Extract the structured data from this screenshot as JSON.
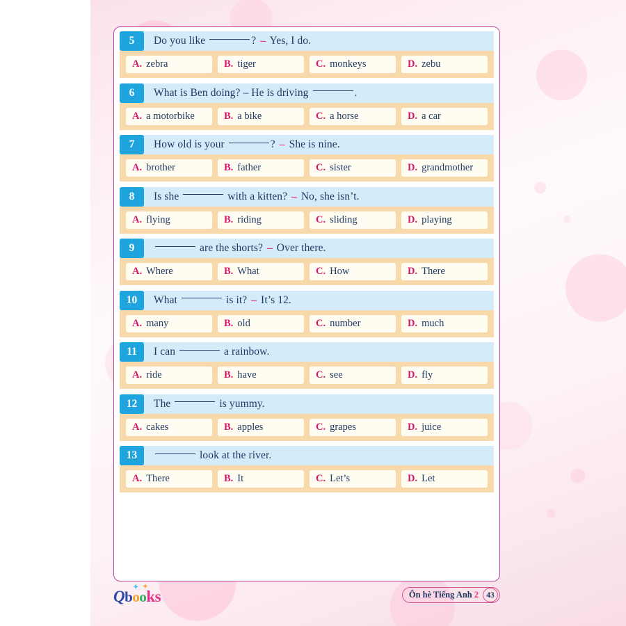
{
  "page": {
    "background_color": "#fbe2ea",
    "card_border_color": "#c0499c",
    "accent_blue": "#1fa5dd",
    "band_blue": "#d4ecfa",
    "band_orange": "#f8d9ab",
    "option_box_color": "#fffdf2",
    "letter_color": "#d6176b",
    "text_color": "#1f3a63",
    "dash_color": "#e8308a"
  },
  "questions": [
    {
      "number": "5",
      "prompt_before": "Do you like ",
      "prompt_after": "? ",
      "dash": "–",
      "prompt_tail": " Yes, I do.",
      "options": [
        {
          "letter": "A.",
          "text": "zebra"
        },
        {
          "letter": "B.",
          "text": "tiger"
        },
        {
          "letter": "C.",
          "text": "monkeys"
        },
        {
          "letter": "D.",
          "text": "zebu"
        }
      ]
    },
    {
      "number": "6",
      "prompt_before": "What is Ben doing? – He is driving ",
      "prompt_after": ".",
      "dash": "",
      "prompt_tail": "",
      "options": [
        {
          "letter": "A.",
          "text": "a motorbike"
        },
        {
          "letter": "B.",
          "text": "a bike"
        },
        {
          "letter": "C.",
          "text": "a horse"
        },
        {
          "letter": "D.",
          "text": "a car"
        }
      ]
    },
    {
      "number": "7",
      "prompt_before": "How old is your ",
      "prompt_after": "? ",
      "dash": "–",
      "prompt_tail": " She is nine.",
      "options": [
        {
          "letter": "A.",
          "text": "brother"
        },
        {
          "letter": "B.",
          "text": "father"
        },
        {
          "letter": "C.",
          "text": "sister"
        },
        {
          "letter": "D.",
          "text": "grandmother"
        }
      ]
    },
    {
      "number": "8",
      "prompt_before": "Is she ",
      "prompt_after": " with a kitten? ",
      "dash": "–",
      "prompt_tail": " No, she isn’t.",
      "options": [
        {
          "letter": "A.",
          "text": "flying"
        },
        {
          "letter": "B.",
          "text": "riding"
        },
        {
          "letter": "C.",
          "text": "sliding"
        },
        {
          "letter": "D.",
          "text": "playing"
        }
      ]
    },
    {
      "number": "9",
      "prompt_before": "",
      "prompt_after": " are the shorts? ",
      "dash": "–",
      "prompt_tail": " Over there.",
      "options": [
        {
          "letter": "A.",
          "text": "Where"
        },
        {
          "letter": "B.",
          "text": "What"
        },
        {
          "letter": "C.",
          "text": "How"
        },
        {
          "letter": "D.",
          "text": "There"
        }
      ]
    },
    {
      "number": "10",
      "prompt_before": "What ",
      "prompt_after": " is it? ",
      "dash": "–",
      "prompt_tail": " It’s 12.",
      "options": [
        {
          "letter": "A.",
          "text": "many"
        },
        {
          "letter": "B.",
          "text": "old"
        },
        {
          "letter": "C.",
          "text": "number"
        },
        {
          "letter": "D.",
          "text": "much"
        }
      ]
    },
    {
      "number": "11",
      "prompt_before": "I can ",
      "prompt_after": " a rainbow.",
      "dash": "",
      "prompt_tail": "",
      "options": [
        {
          "letter": "A.",
          "text": "ride"
        },
        {
          "letter": "B.",
          "text": "have"
        },
        {
          "letter": "C.",
          "text": "see"
        },
        {
          "letter": "D.",
          "text": "fly"
        }
      ]
    },
    {
      "number": "12",
      "prompt_before": "The ",
      "prompt_after": " is yummy.",
      "dash": "",
      "prompt_tail": "",
      "options": [
        {
          "letter": "A.",
          "text": "cakes"
        },
        {
          "letter": "B.",
          "text": "apples"
        },
        {
          "letter": "C.",
          "text": "grapes"
        },
        {
          "letter": "D.",
          "text": "juice"
        }
      ]
    },
    {
      "number": "13",
      "prompt_before": "",
      "prompt_after": " look at the river.",
      "dash": "",
      "prompt_tail": "",
      "options": [
        {
          "letter": "A.",
          "text": "There"
        },
        {
          "letter": "B.",
          "text": "It"
        },
        {
          "letter": "C.",
          "text": "Let’s"
        },
        {
          "letter": "D.",
          "text": "Let"
        }
      ]
    }
  ],
  "footer": {
    "logo": {
      "q": "Q",
      "b": "b",
      "o1": "o",
      "o2": "o",
      "k_s": "ks"
    },
    "book_title": "Ôn hè Tiếng Anh",
    "grade": "2",
    "page_number": "43"
  }
}
